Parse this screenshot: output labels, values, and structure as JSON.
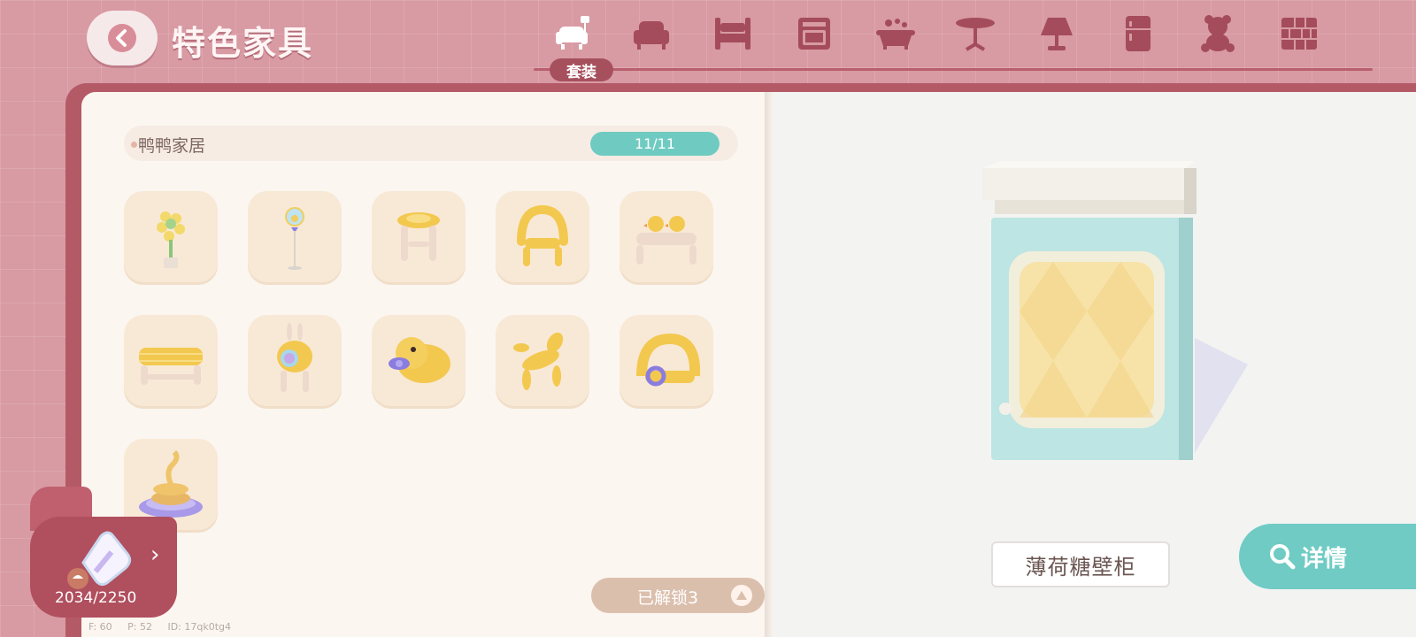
{
  "header": {
    "title": "特色家具",
    "active_tab_label": "套装",
    "tabs": [
      {
        "icon": "suit-set-icon",
        "active": true
      },
      {
        "icon": "sofa-icon"
      },
      {
        "icon": "bed-icon"
      },
      {
        "icon": "cabinet-icon"
      },
      {
        "icon": "bathtub-icon"
      },
      {
        "icon": "table-icon"
      },
      {
        "icon": "lamp-icon"
      },
      {
        "icon": "fridge-icon"
      },
      {
        "icon": "teddy-bear-icon"
      },
      {
        "icon": "wall-brick-icon"
      }
    ]
  },
  "set": {
    "name": "鸭鸭家居",
    "progress": "11/11"
  },
  "items": [
    {
      "icon": "flower-pot-icon"
    },
    {
      "icon": "balloon-stand-icon"
    },
    {
      "icon": "balloon-stool-icon"
    },
    {
      "icon": "balloon-chair-icon"
    },
    {
      "icon": "duck-bench-icon"
    },
    {
      "icon": "balloon-bench-icon"
    },
    {
      "icon": "bunny-lamp-icon"
    },
    {
      "icon": "duck-head-icon"
    },
    {
      "icon": "balloon-dog-icon"
    },
    {
      "icon": "balloon-arch-icon"
    },
    {
      "icon": "spring-toy-icon"
    }
  ],
  "unlock_button": {
    "label": "已解锁3"
  },
  "collection": {
    "count": "2034/2250"
  },
  "debug": {
    "text": "F: 60     P: 52     ID: 17qk0tg4"
  },
  "preview": {
    "item_name": "薄荷糖壁柜"
  },
  "details_button": {
    "label": "详情"
  },
  "colors": {
    "background": "#d89aa3",
    "accent_teal": "#6fcbc1",
    "book_cover": "#b45a67",
    "slot": "#f8e9d6",
    "icon_fill": "#a44c5b"
  }
}
